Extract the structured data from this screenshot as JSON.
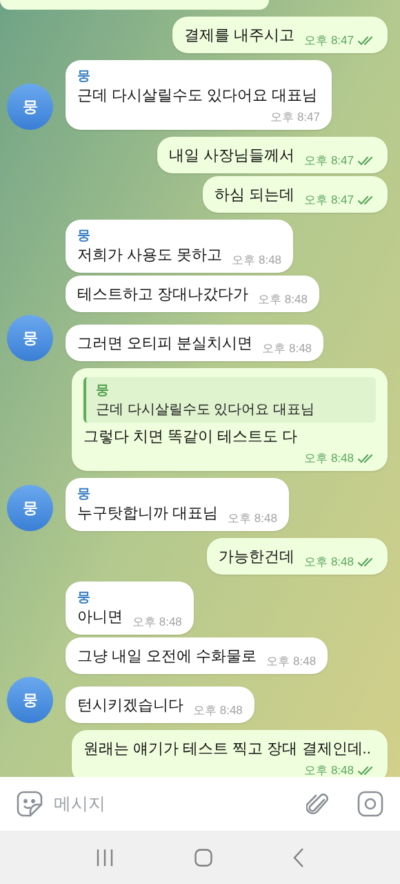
{
  "messages": [
    {
      "kind": "partial"
    },
    {
      "kind": "out",
      "text": "결제를 내주시고",
      "time": "오후 8:47",
      "read": true
    },
    {
      "kind": "in",
      "sender": "뭉",
      "text": "근데 다시살릴수도 있다어요 대표님",
      "time": "오후 8:47",
      "avatar": "뭉"
    },
    {
      "kind": "out",
      "text": "내일 사장님들께서",
      "time": "오후 8:47",
      "read": true
    },
    {
      "kind": "out",
      "text": "하심 되는데",
      "time": "오후 8:47",
      "read": true
    },
    {
      "kind": "in",
      "sender": "뭉",
      "text": "저희가 사용도 못하고",
      "time": "오후 8:48"
    },
    {
      "kind": "in",
      "text": "테스트하고 장대나갔다가",
      "time": "오후 8:48"
    },
    {
      "kind": "in",
      "text": "그러면 오티피 분실치시면",
      "time": "오후 8:48",
      "avatar": "뭉"
    },
    {
      "kind": "out",
      "reply": {
        "sender": "뭉",
        "text": "근데 다시살릴수도 있다어요 대표님"
      },
      "text": "그렇다 치면 똑같이 테스트도 다",
      "time": "오후 8:48",
      "read": true
    },
    {
      "kind": "in",
      "sender": "뭉",
      "text": "누구탓합니까 대표님",
      "time": "오후 8:48",
      "avatar": "뭉"
    },
    {
      "kind": "out",
      "text": "가능한건데",
      "time": "오후 8:48",
      "read": true
    },
    {
      "kind": "in",
      "sender": "뭉",
      "text": "아니면",
      "time": "오후 8:48"
    },
    {
      "kind": "in",
      "text": "그냥 내일 오전에 수화물로",
      "time": "오후 8:48"
    },
    {
      "kind": "in",
      "text": "턴시키겠습니다",
      "time": "오후 8:48",
      "avatar": "뭉"
    },
    {
      "kind": "out",
      "text": "원래는 얘기가 테스트 찍고 장대 결제인데..",
      "time": "오후 8:48",
      "read": true
    }
  ],
  "composer": {
    "placeholder": "메시지"
  }
}
